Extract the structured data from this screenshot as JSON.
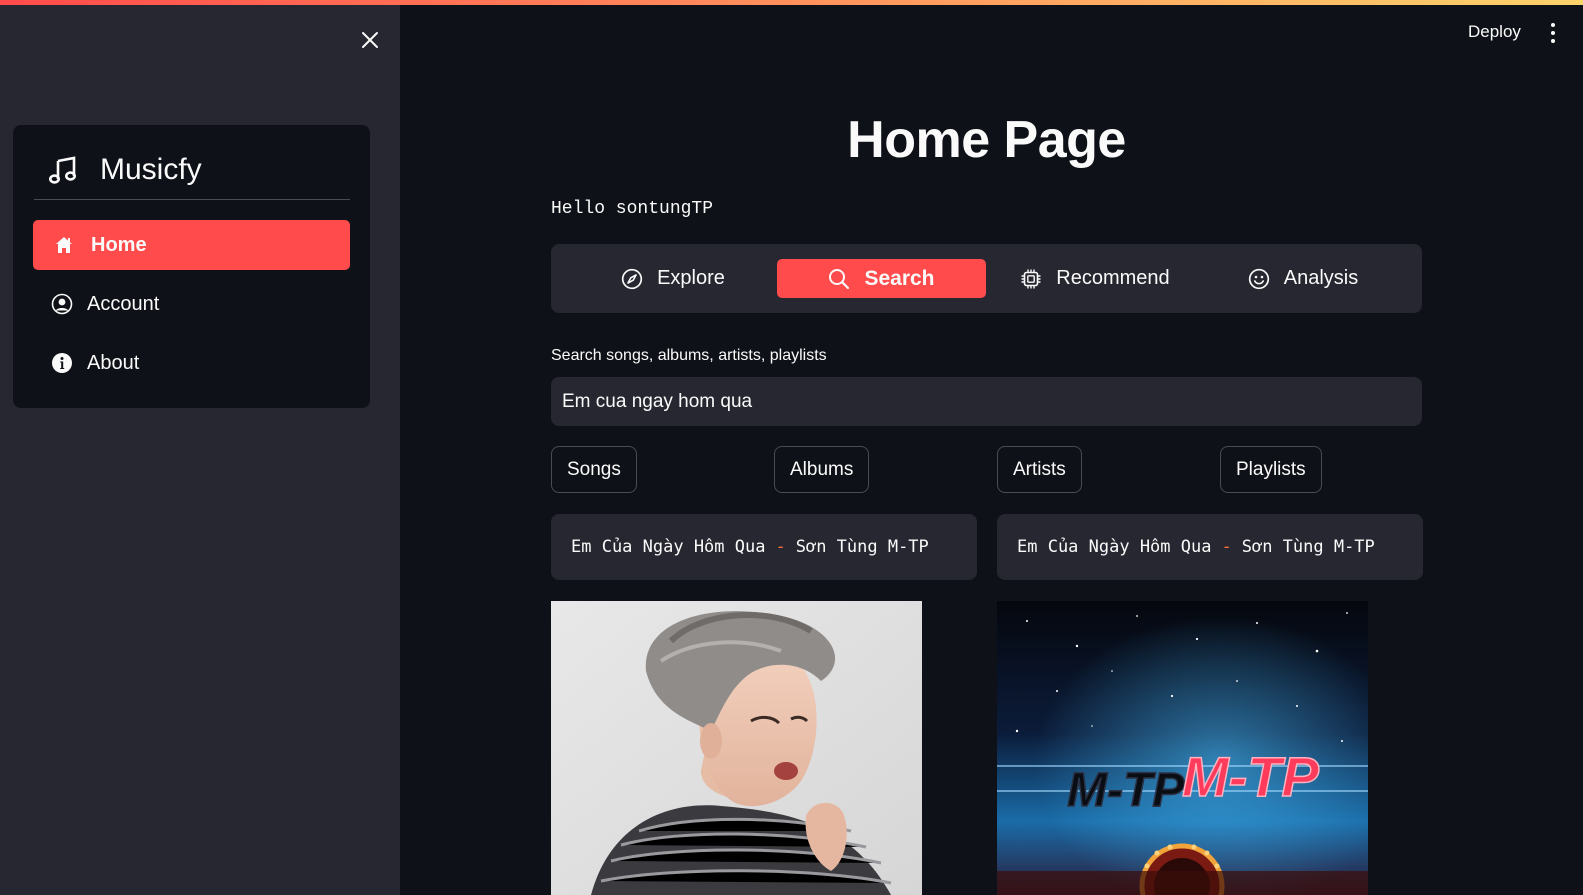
{
  "header": {
    "deploy_label": "Deploy"
  },
  "sidebar": {
    "brand": "Musicfy",
    "items": [
      {
        "label": "Home",
        "icon": "house-icon",
        "active": true
      },
      {
        "label": "Account",
        "icon": "person-circle-icon",
        "active": false
      },
      {
        "label": "About",
        "icon": "info-circle-icon",
        "active": false
      }
    ]
  },
  "main": {
    "title": "Home Page",
    "greeting": "Hello sontungTP",
    "tabs": [
      {
        "label": "Explore",
        "icon": "compass-icon",
        "active": false
      },
      {
        "label": "Search",
        "icon": "search-icon",
        "active": true
      },
      {
        "label": "Recommend",
        "icon": "cpu-icon",
        "active": false
      },
      {
        "label": "Analysis",
        "icon": "emoji-smile-icon",
        "active": false
      }
    ],
    "search": {
      "label": "Search songs, albums, artists, playlists",
      "value": "Em cua ngay hom qua"
    },
    "filters": [
      "Songs",
      "Albums",
      "Artists",
      "Playlists"
    ],
    "results": [
      {
        "title": "Em Của Ngày Hôm Qua",
        "separator": "-",
        "artist": "Sơn Tùng M-TP"
      },
      {
        "title": "Em Của Ngày Hôm Qua",
        "separator": "-",
        "artist": "Sơn Tùng M-TP"
      }
    ],
    "album_art_text": "M-TP"
  },
  "colors": {
    "accent": "#ff4b4b",
    "background": "#0e1117",
    "sidebar": "#262730"
  }
}
